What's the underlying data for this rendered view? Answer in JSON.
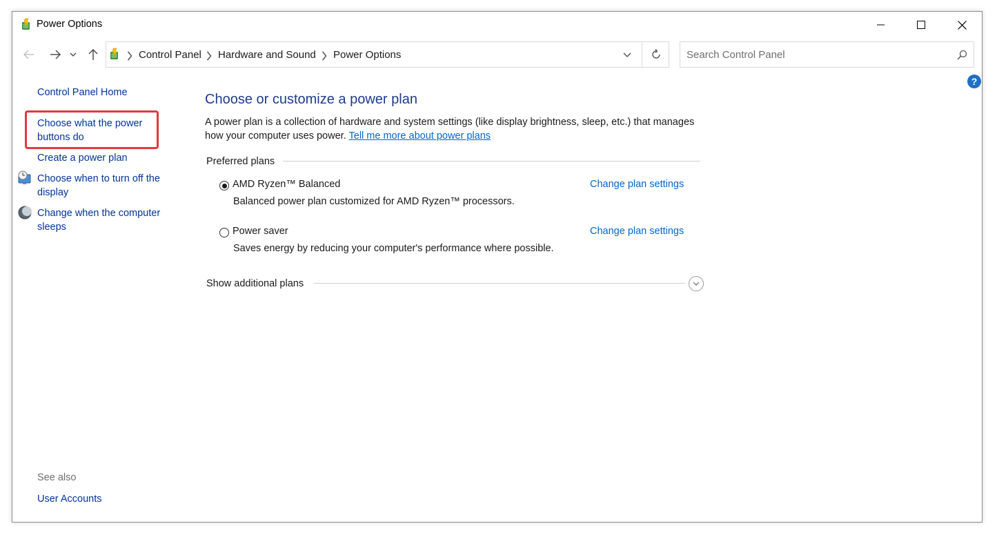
{
  "window": {
    "title": "Power Options",
    "app_icon": "power-options-icon"
  },
  "nav": {
    "back_icon": "arrow-left-icon",
    "forward_icon": "arrow-right-icon",
    "recent_icon": "chevron-down-icon",
    "up_icon": "arrow-up-icon",
    "breadcrumb": [
      "Control Panel",
      "Hardware and Sound",
      "Power Options"
    ],
    "refresh_icon": "refresh-icon",
    "search_placeholder": "Search Control Panel"
  },
  "sidebar": {
    "home": "Control Panel Home",
    "items": [
      {
        "label": "Choose what the power buttons do",
        "icon": null,
        "highlighted": true
      },
      {
        "label": "Create a power plan",
        "icon": null
      },
      {
        "label": "Choose when to turn off the display",
        "icon": "monitor-clock-icon"
      },
      {
        "label": "Change when the computer sleeps",
        "icon": "moon-icon"
      }
    ],
    "see_also": "See also",
    "see_also_items": [
      "User Accounts"
    ]
  },
  "main": {
    "heading": "Choose or customize a power plan",
    "description": "A power plan is a collection of hardware and system settings (like display brightness, sleep, etc.) that manages how your computer uses power.",
    "learn_more": "Tell me more about power plans",
    "preferred_title": "Preferred plans",
    "plans": [
      {
        "name": "AMD Ryzen™ Balanced",
        "description": "Balanced power plan customized for AMD Ryzen™ processors.",
        "selected": true,
        "link": "Change plan settings"
      },
      {
        "name": "Power saver",
        "description": "Saves energy by reducing your computer's performance where possible.",
        "selected": false,
        "link": "Change plan settings"
      }
    ],
    "additional_title": "Show additional plans"
  },
  "colors": {
    "link": "#0066cc",
    "nav_link": "#003399",
    "heading": "#1e3c8c",
    "highlight": "#e0393e"
  }
}
